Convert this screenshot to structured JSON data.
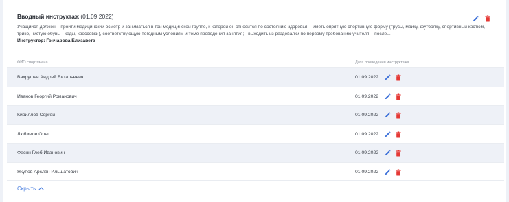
{
  "briefing": {
    "title": "Вводный инструктаж",
    "date": "(01.09.2022)",
    "description": "Учащийся должен: - пройти медицинский осмотр и заниматься в той медицинской группе, к которой он относится по состоянию здоровья; - иметь опрятную спортивную форму (трусы, майку, футболку, спортивный костюм, трико, чистую обувь – кеды, кроссовки), соответствующую погодным условиям и теме проведения занятия; - выходить из раздевалки по первому требованию учителя; - после...",
    "instructor": "Инструктор: Гончарова Елизавета"
  },
  "table": {
    "headers": {
      "name": "ФИО спортсмена",
      "date": "Дата проведения инструктажа"
    },
    "rows": [
      {
        "name": "Вахрушев Андрей Витальевич",
        "date": "01.09.2022"
      },
      {
        "name": "Иванов Георгий Романович",
        "date": "01.09.2022"
      },
      {
        "name": "Кириллов Сергей",
        "date": "01.09.2022"
      },
      {
        "name": "Любимов Олег",
        "date": "01.09.2022"
      },
      {
        "name": "Феснн Глеб Иванович",
        "date": "01.09.2022"
      },
      {
        "name": "Якупов Арслан Ильшатович",
        "date": "01.09.2022"
      }
    ]
  },
  "footer": {
    "hide_label": "Скрыть"
  },
  "icons": {
    "edit": "pencil-icon",
    "delete": "trash-icon",
    "collapse": "chevron-up-icon"
  },
  "colors": {
    "accent": "#4a7fe0",
    "edit": "#3b6fd8",
    "delete": "#e53935",
    "row_alt": "#eef1f7"
  }
}
